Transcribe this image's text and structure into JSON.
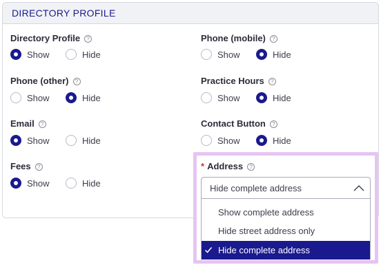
{
  "section": {
    "title": "DIRECTORY PROFILE"
  },
  "choices": {
    "show": "Show",
    "hide": "Hide"
  },
  "fields": {
    "directory_profile": {
      "label": "Directory Profile",
      "value": "Show"
    },
    "phone_mobile": {
      "label": "Phone (mobile)",
      "value": "Hide"
    },
    "phone_other": {
      "label": "Phone (other)",
      "value": "Hide"
    },
    "practice_hours": {
      "label": "Practice Hours",
      "value": "Hide"
    },
    "email": {
      "label": "Email",
      "value": "Show"
    },
    "contact_button": {
      "label": "Contact Button",
      "value": "Hide"
    },
    "fees": {
      "label": "Fees",
      "value": "Show"
    }
  },
  "address": {
    "required_mark": "*",
    "label": "Address",
    "selected": "Hide complete address",
    "options": [
      {
        "label": "Show complete address",
        "selected": false
      },
      {
        "label": "Hide street address only",
        "selected": false
      },
      {
        "label": "Hide complete address",
        "selected": true
      }
    ]
  },
  "colors": {
    "accent": "#1a1a8e",
    "focus_highlight": "#e6c4f2",
    "required": "#d0312d"
  },
  "icons": {
    "help": "question-circle-icon",
    "dropdown": "chevron-up-icon",
    "selected_option": "check-icon"
  }
}
